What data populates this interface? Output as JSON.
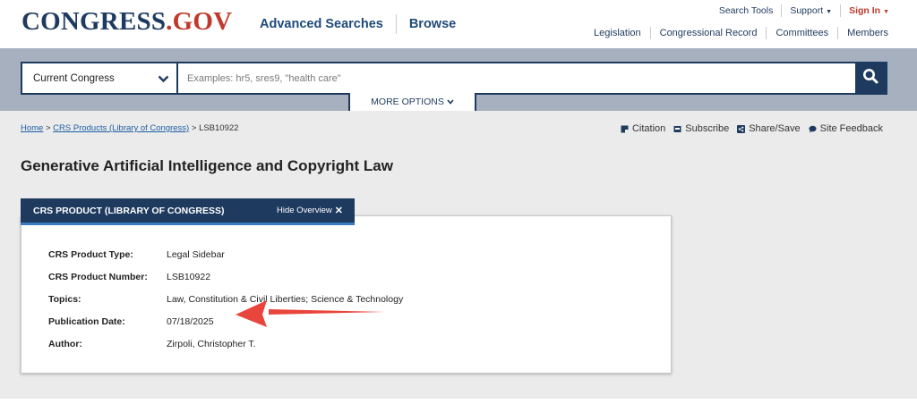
{
  "header": {
    "logo_main": "CONGRESS",
    "logo_dot": ".",
    "logo_suffix": "GOV",
    "nav": [
      "Advanced Searches",
      "Browse"
    ],
    "top_links": {
      "search_tools": "Search Tools",
      "support": "Support",
      "sign_in": "Sign In"
    },
    "sub_links": [
      "Legislation",
      "Congressional Record",
      "Committees",
      "Members"
    ]
  },
  "search": {
    "scope": "Current Congress",
    "placeholder": "Examples: hr5, sres9, \"health care\"",
    "more_options": "MORE OPTIONS"
  },
  "breadcrumb": {
    "home": "Home",
    "sep1": " > ",
    "section": "CRS Products (Library of Congress)",
    "sep2": " > ",
    "current": "LSB10922"
  },
  "tools": {
    "citation": "Citation",
    "subscribe": "Subscribe",
    "share": "Share/Save",
    "feedback": "Site Feedback"
  },
  "page": {
    "title": "Generative Artificial Intelligence and Copyright Law"
  },
  "overview": {
    "tab_label": "CRS PRODUCT (LIBRARY OF CONGRESS)",
    "hide_label": "Hide Overview",
    "rows": [
      {
        "key": "CRS Product Type:",
        "value": "Legal Sidebar"
      },
      {
        "key": "CRS Product Number:",
        "value": "LSB10922"
      },
      {
        "key": "Topics:",
        "value": "Law, Constitution & Civil Liberties; Science & Technology"
      },
      {
        "key": "Publication Date:",
        "value": "07/18/2025"
      },
      {
        "key": "Author:",
        "value": "Zirpoli, Christopher T."
      }
    ]
  },
  "colors": {
    "brand_navy": "#1e3a5f",
    "brand_red": "#c0392b",
    "annotation_arrow": "#e8453c"
  }
}
